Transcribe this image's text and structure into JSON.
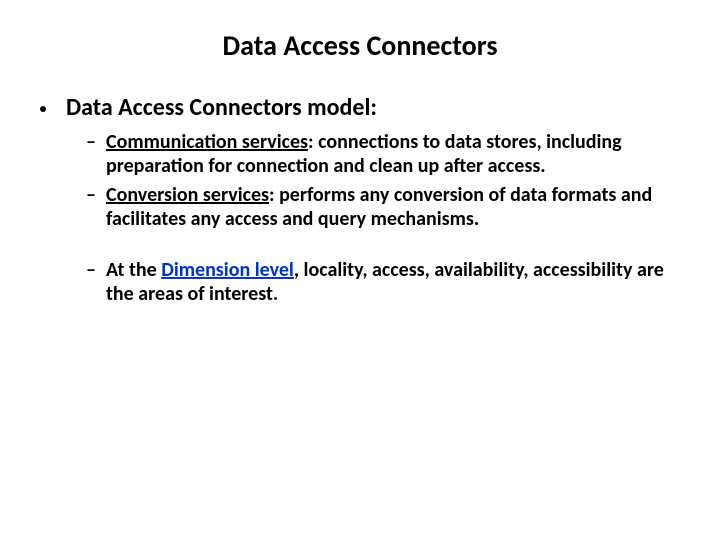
{
  "title": "Data Access Connectors",
  "lvl1": {
    "label": "Data Access Connectors model:"
  },
  "items": [
    {
      "head": "Communication services",
      "sep": ": ",
      "tail": "connections to data stores, including preparation for connection and clean up after access."
    },
    {
      "head": "Conversion services",
      "sep": ": ",
      "tail": "performs any conversion of data formats and facilitates any access and query mechanisms."
    }
  ],
  "dim": {
    "pre": "At the ",
    "blue": "Dimension level",
    "post": ", locality, access, availability, accessibility are the areas of interest."
  }
}
